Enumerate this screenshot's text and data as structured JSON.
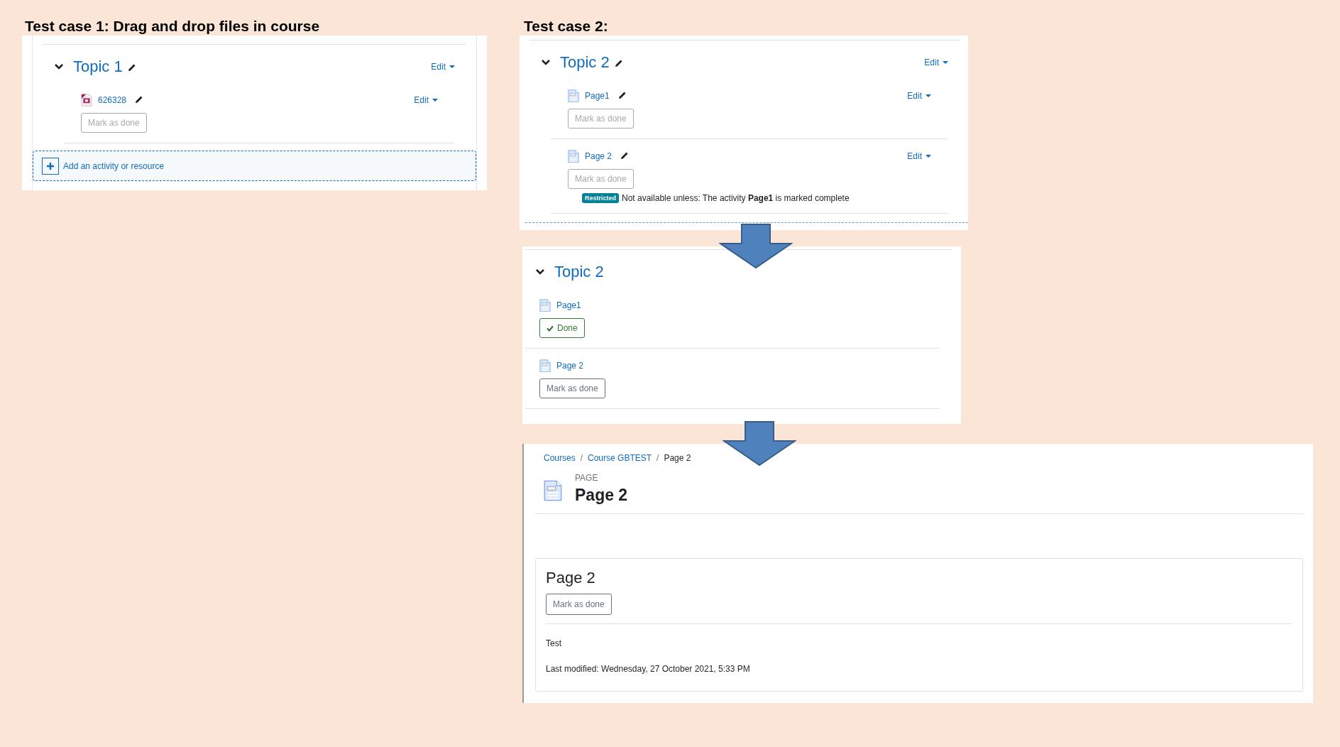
{
  "test_case_1": {
    "heading": "Test case 1: Drag and drop files in course",
    "section": {
      "title": "Topic 1",
      "editing": true,
      "edit": "Edit",
      "activities": [
        {
          "kind": "file",
          "name": "626328",
          "edit": "Edit",
          "completion": {
            "label": "Mark as done",
            "done": false,
            "disabled": true
          }
        }
      ],
      "add_activity": "Add an activity or resource"
    }
  },
  "test_case_2": {
    "heading": "Test case 2:",
    "before": {
      "title": "Topic 2",
      "editing": true,
      "edit": "Edit",
      "activities": [
        {
          "kind": "page",
          "name": "Page1",
          "edit": "Edit",
          "completion": {
            "label": "Mark as done",
            "done": false,
            "disabled": true
          }
        },
        {
          "kind": "page",
          "name": "Page 2",
          "edit": "Edit",
          "completion": {
            "label": "Mark as done",
            "done": false,
            "disabled": true
          },
          "restriction": {
            "badge": "Restricted",
            "text": "Not available unless: The activity **Page1** is marked complete"
          }
        }
      ]
    },
    "after": {
      "title": "Topic 2",
      "editing": false,
      "activities": [
        {
          "kind": "page",
          "name": "Page1",
          "completion": {
            "label": "Done",
            "done": true,
            "disabled": false
          }
        },
        {
          "kind": "page",
          "name": "Page 2",
          "completion": {
            "label": "Mark as done",
            "done": false,
            "disabled": false
          }
        }
      ]
    },
    "page_view": {
      "breadcrumb": [
        {
          "label": "Courses",
          "link": true
        },
        {
          "label": "Course GBTEST",
          "link": true
        },
        {
          "label": "Page 2",
          "link": false
        }
      ],
      "separator": "/",
      "module_type": "PAGE",
      "title": "Page 2",
      "content_title": "Page 2",
      "completion": {
        "label": "Mark as done",
        "done": false,
        "disabled": false
      },
      "body": "Test",
      "last_modified": "Last modified: Wednesday, 27 October 2021, 5:33 PM"
    }
  }
}
